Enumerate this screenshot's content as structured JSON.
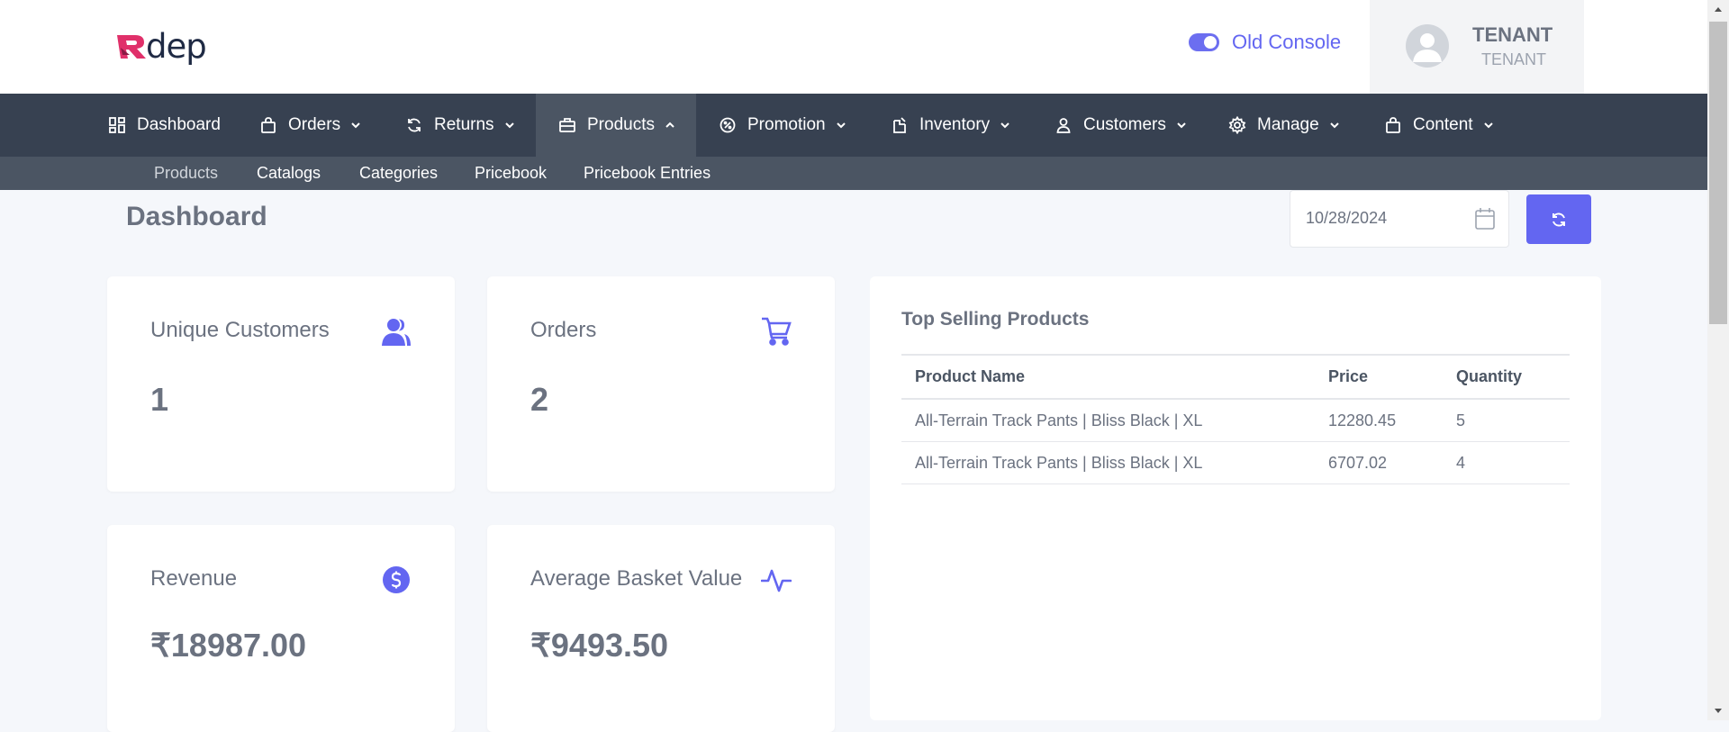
{
  "brand": {
    "logo_text": "dep"
  },
  "header": {
    "toggle_label": "Old Console",
    "user_name": "TENANT",
    "user_role": "TENANT"
  },
  "nav": {
    "items": [
      {
        "label": "Dashboard",
        "icon": "dashboard-icon"
      },
      {
        "label": "Orders",
        "icon": "bag-icon"
      },
      {
        "label": "Returns",
        "icon": "refresh-icon"
      },
      {
        "label": "Products",
        "icon": "briefcase-icon",
        "active": true
      },
      {
        "label": "Promotion",
        "icon": "badge-icon"
      },
      {
        "label": "Inventory",
        "icon": "inventory-icon"
      },
      {
        "label": "Customers",
        "icon": "user-icon"
      },
      {
        "label": "Manage",
        "icon": "gear-icon"
      },
      {
        "label": "Content",
        "icon": "bag-icon"
      }
    ],
    "sub_items": [
      "Products",
      "Catalogs",
      "Categories",
      "Pricebook",
      "Pricebook Entries"
    ]
  },
  "main": {
    "title": "Dashboard",
    "date_value": "10/28/2024",
    "cards": [
      {
        "title": "Unique Customers",
        "value": "1",
        "icon": "users-icon"
      },
      {
        "title": "Orders",
        "value": "2",
        "icon": "cart-icon"
      },
      {
        "title": "Revenue",
        "value": "₹18987.00",
        "icon": "dollar-icon"
      },
      {
        "title": "Average Basket Value",
        "value": "₹9493.50",
        "icon": "activity-icon"
      }
    ],
    "top_selling": {
      "title": "Top Selling Products",
      "columns": [
        "Product Name",
        "Price",
        "Quantity"
      ],
      "rows": [
        [
          "All-Terrain Track Pants | Bliss Black | XL",
          "12280.45",
          "5"
        ],
        [
          "All-Terrain Track Pants | Bliss Black | XL",
          "6707.02",
          "4"
        ]
      ]
    }
  },
  "colors": {
    "accent": "#6366f1",
    "nav_bg": "#374151",
    "subnav_bg": "#4b5563",
    "logo_pink": "#e0306a"
  }
}
